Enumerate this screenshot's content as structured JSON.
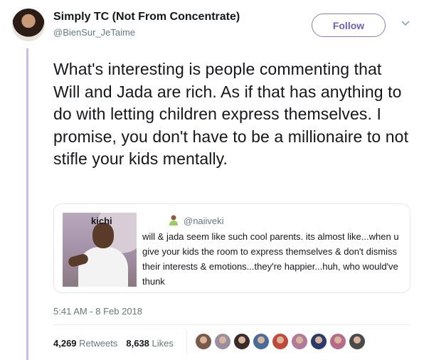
{
  "author": {
    "display_name": "Simply TC (Not From Concentrate)",
    "handle": "@BienSur_JeTaime"
  },
  "follow_label": "Follow",
  "tweet_text": "What's interesting is people commenting that Will and Jada are rich. As if that has anything to do with letting children express themselves. I promise, you don't have to be a millionaire to not stifle your kids mentally.",
  "quoted_tweet": {
    "name": "kichi",
    "name_emoji": "🙎🏾‍♂️",
    "handle": "@naiiveki",
    "text": "will & jada seem like such cool parents.  its almost like...when u give your kids the room to express themselves & don't dismiss their interests & emotions...they're happier...huh, who would've thunk"
  },
  "timestamp": "5:41 AM - 8 Feb 2018",
  "stats": {
    "retweets_count": "4,269",
    "retweets_label": "Retweets",
    "likes_count": "8,638",
    "likes_label": "Likes"
  },
  "likers": [
    {
      "color": "#7a5a4a"
    },
    {
      "color": "#9a8fa0"
    },
    {
      "color": "#3a2a2a"
    },
    {
      "color": "#4a6a9a"
    },
    {
      "color": "#c04a3a"
    },
    {
      "color": "#b07a9a"
    },
    {
      "color": "#2a3a6a"
    },
    {
      "color": "#b86a8a"
    },
    {
      "color": "#4a4a4a"
    }
  ]
}
